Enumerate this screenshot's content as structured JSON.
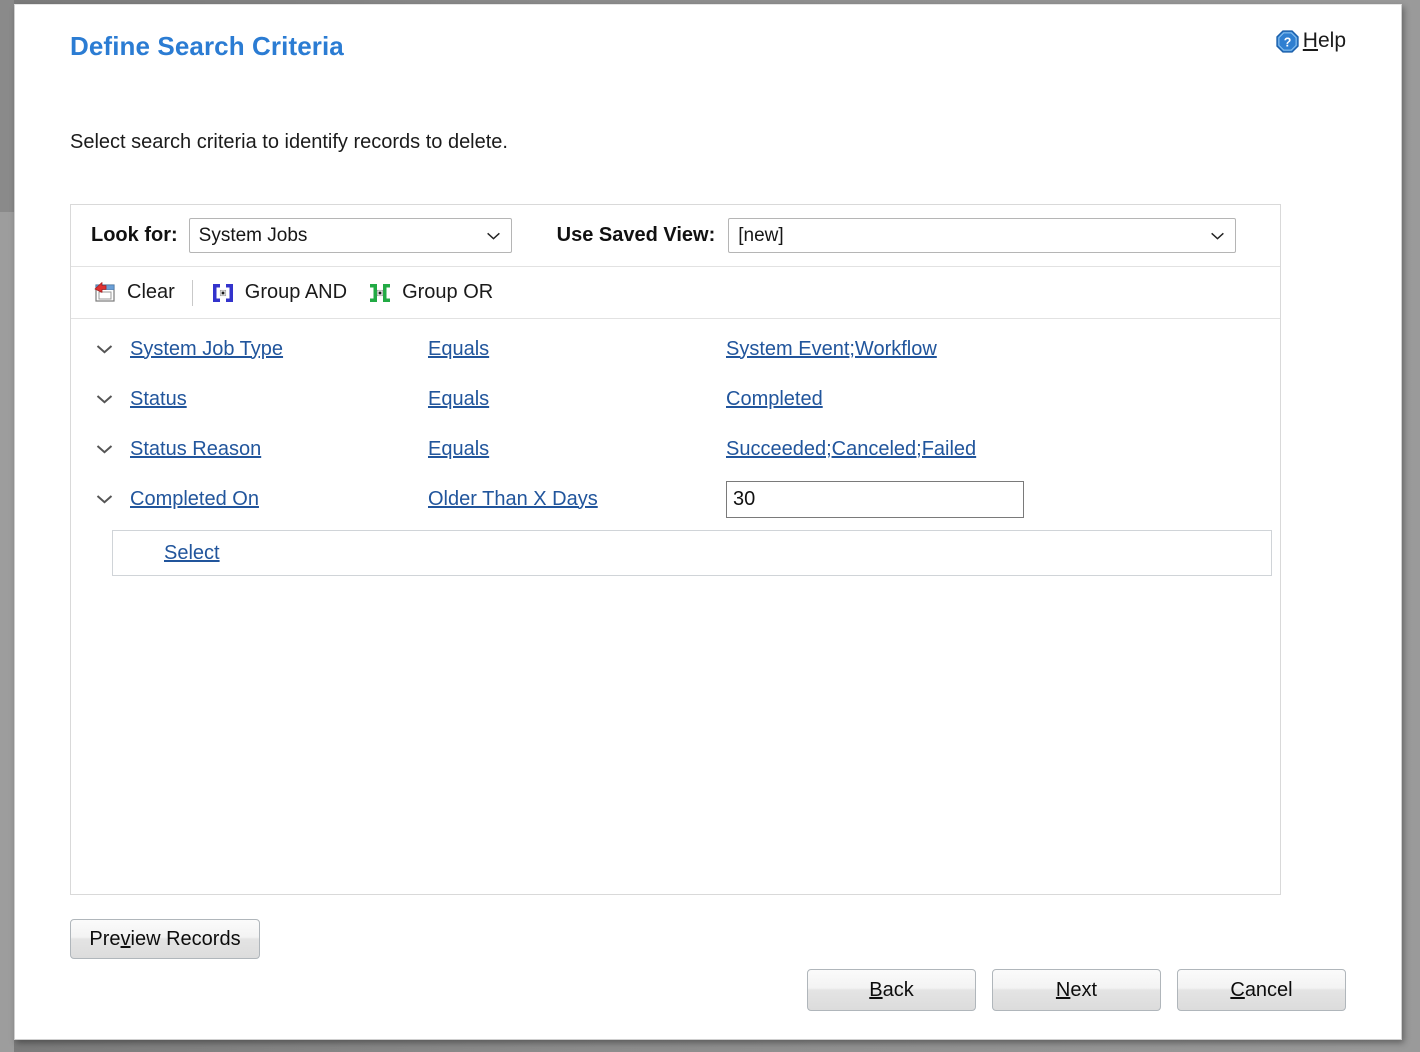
{
  "window": {
    "title": "Define Search Criteria",
    "accent_color": "#2b7cd3",
    "link_color": "#21559c"
  },
  "header": {
    "help_prefix": "H",
    "help_rest": "elp",
    "help_icon": "help-question-icon"
  },
  "instruction": "Select search criteria to identify records to delete.",
  "lookfor": {
    "label": "Look for:",
    "value": "System Jobs",
    "chevron_icon": "chevron-down-icon"
  },
  "saved_view": {
    "label": "Use Saved View:",
    "value": "[new]",
    "chevron_icon": "chevron-down-icon"
  },
  "toolbar": {
    "clear": {
      "label": "Clear",
      "icon": "clear-window-red-arrow-icon"
    },
    "group_and": {
      "label": "Group AND",
      "icon": "group-and-brackets-icon",
      "color": "#3333cc"
    },
    "group_or": {
      "label": "Group OR",
      "icon": "group-or-brackets-icon",
      "color": "#22aa44"
    }
  },
  "criteria": {
    "rows": [
      {
        "chevron": "chevron-down-icon",
        "attribute": "System Job Type",
        "operator": "Equals",
        "value": "System Event;Workflow",
        "value_type": "link"
      },
      {
        "chevron": "chevron-down-icon",
        "attribute": "Status",
        "operator": "Equals",
        "value": "Completed",
        "value_type": "link"
      },
      {
        "chevron": "chevron-down-icon",
        "attribute": "Status Reason",
        "operator": "Equals",
        "value": "Succeeded;Canceled;Failed",
        "value_type": "link"
      },
      {
        "chevron": "chevron-down-icon",
        "attribute": "Completed On",
        "operator": "Older Than X Days",
        "value": "30",
        "value_type": "input"
      }
    ],
    "select_row_label": "Select"
  },
  "buttons": {
    "preview": {
      "pre": "Pre",
      "accel": "v",
      "post": "iew Records"
    },
    "back": {
      "accel": "B",
      "post": "ack"
    },
    "next": {
      "accel": "N",
      "post": "ext"
    },
    "cancel": {
      "accel": "C",
      "post": "ancel"
    }
  }
}
